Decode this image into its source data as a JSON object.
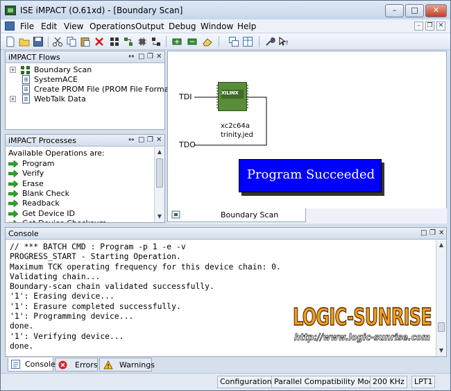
{
  "window": {
    "title": "ISE iMPACT (O.61xd) - [Boundary Scan]",
    "controls": {
      "minimize": "–",
      "maximize": "□",
      "close": "✕"
    }
  },
  "menubar": {
    "items": [
      "File",
      "Edit",
      "View",
      "Operations",
      "Output",
      "Debug",
      "Window",
      "Help"
    ],
    "mdi_controls": {
      "minimize": "–",
      "restore": "❐",
      "close": "✕"
    }
  },
  "toolbar": {
    "icons": [
      "new-icon",
      "open-icon",
      "save-icon",
      "cut-icon",
      "copy-icon",
      "paste-icon",
      "delete-icon",
      "chain-icon",
      "chain2-icon",
      "debug-icon",
      "chain3-icon",
      "add-device-icon",
      "add-device2-icon",
      "erase-icon",
      "cascade-icon",
      "tile-icon",
      "wrench-icon",
      "whats-this-icon"
    ]
  },
  "flows_panel": {
    "title": "iMPACT Flows",
    "controls": {
      "float": "↔",
      "restore": "□",
      "maximize": "❐",
      "close": "✕"
    },
    "items": [
      {
        "label": "Boundary Scan",
        "icon": "boundary-scan-icon",
        "expander": "+"
      },
      {
        "label": "SystemACE",
        "icon": "document-icon",
        "expander": ""
      },
      {
        "label": "Create PROM File (PROM File Format...",
        "icon": "document-icon",
        "expander": ""
      },
      {
        "label": "WebTalk Data",
        "icon": "document-icon",
        "expander": "+"
      }
    ]
  },
  "processes_panel": {
    "title": "iMPACT Processes",
    "controls": {
      "float": "↔",
      "restore": "□",
      "maximize": "❐",
      "close": "✕"
    },
    "heading": "Available Operations are:",
    "operations": [
      "Program",
      "Verify",
      "Erase",
      "Blank Check",
      "Readback",
      "Get Device ID",
      "Get Device Checksum"
    ],
    "scroll": {
      "up": "▲",
      "down": "▼"
    }
  },
  "boundary_scan": {
    "tdi_label": "TDI",
    "tdo_label": "TDO",
    "chip_logo": "XILINX",
    "device_name": "xc2c64a",
    "device_file": "trinity.jed",
    "status_banner": "Program Succeeded",
    "tab_label": "Boundary Scan",
    "colors": {
      "banner": "#0000ff",
      "chip": "#5a8c3a"
    }
  },
  "console_panel": {
    "title": "Console",
    "controls": {
      "restore": "□",
      "maximize": "❐",
      "close": "✕"
    },
    "lines": [
      "// *** BATCH CMD : Program -p 1 -e -v",
      "PROGRESS_START - Starting Operation.",
      "Maximum TCK operating frequency for this device chain: 0.",
      "Validating chain...",
      "Boundary-scan chain validated successfully.",
      "'1': Erasing device...",
      "'1': Erasure completed successfully.",
      "'1': Programming device...",
      "done.",
      "'1': Verifying device...",
      "done."
    ],
    "scroll": {
      "up": "▲",
      "down": "▼"
    },
    "tabs": [
      {
        "label": "Console",
        "icon": "console-icon"
      },
      {
        "label": "Errors",
        "icon": "error-icon"
      },
      {
        "label": "Warnings",
        "icon": "warning-icon"
      }
    ]
  },
  "watermark": {
    "title": "LOGIC-SUNRISE",
    "url": "http://www.logic-sunrise.com"
  },
  "statusbar": {
    "cells": [
      "Configuration",
      "Parallel Compatibility Mode",
      "200 KHz",
      "LPT1"
    ]
  }
}
